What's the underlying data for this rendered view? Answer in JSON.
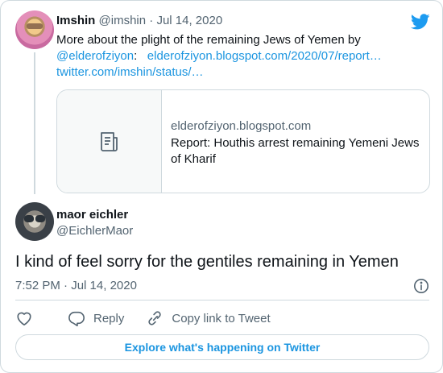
{
  "parent_tweet": {
    "author_name": "Imshin",
    "author_handle": "@imshin",
    "separator": "·",
    "date": "Jul 14, 2020",
    "text_intro": "More about the plight of the remaining Jews of Yemen by",
    "mention": "@elderofziyon",
    "colon": ":",
    "link_url": "elderofziyon.blogspot.com/2020/07/report…",
    "link_status": "twitter.com/imshin/status/…",
    "card": {
      "domain": "elderofziyon.blogspot.com",
      "title": "Report: Houthis arrest remaining Yemeni Jews of Kharif"
    }
  },
  "main_tweet": {
    "author_name": "maor eichler",
    "author_handle": "@EichlerMaor",
    "text": "I kind of feel sorry for the gentiles remaining in Yemen",
    "time": "7:52 PM",
    "separator": "·",
    "date": "Jul 14, 2020"
  },
  "actions": {
    "reply_label": "Reply",
    "copy_link_label": "Copy link to Tweet"
  },
  "explore_label": "Explore what's happening on Twitter",
  "colors": {
    "link": "#1b95e0",
    "twitter_blue": "#1d9bf0",
    "muted": "#536471",
    "border": "#cfd9de"
  }
}
